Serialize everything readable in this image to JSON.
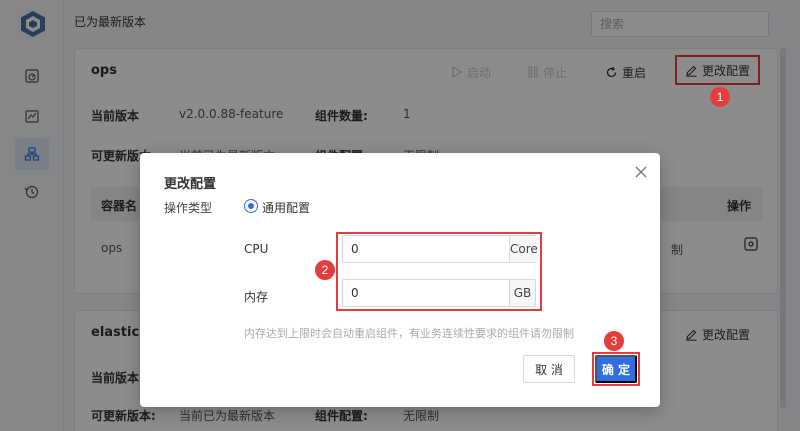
{
  "topbar": {
    "status": "已为最新版本",
    "search_placeholder": "搜索"
  },
  "sidebar": {
    "items": [
      {
        "icon": "dashboard-icon"
      },
      {
        "icon": "chart-icon"
      },
      {
        "icon": "deploy-icon"
      },
      {
        "icon": "history-icon"
      }
    ]
  },
  "card1": {
    "title": "ops",
    "actions": {
      "start": "启动",
      "stop": "停止",
      "restart": "重启",
      "change_config": "更改配置"
    },
    "info": {
      "current_version_label": "当前版本",
      "current_version": "v2.0.0.88-feature",
      "component_count_label": "组件数量:",
      "component_count": "1",
      "updatable_label": "可更新版本:",
      "updatable_value": "当前已为最新版本",
      "component_config_label": "组件配置:",
      "component_config_value": "无限制"
    },
    "table": {
      "headers": [
        "容器名",
        "操作"
      ],
      "row": {
        "name": "ops",
        "limit": "制"
      }
    }
  },
  "card2": {
    "title": "elasticse",
    "change_config": "更改配置",
    "info": {
      "current_version_label": "当前版本",
      "updatable_label": "可更新版本:",
      "updatable_value": "当前已为最新版本",
      "component_config_label": "组件配置:",
      "component_config_value": "无限制"
    }
  },
  "modal": {
    "title": "更改配置",
    "op_type_label": "操作类型",
    "radio_label": "通用配置",
    "cpu_label": "CPU",
    "cpu_value": "0",
    "cpu_unit": "Core",
    "mem_label": "内存",
    "mem_value": "0",
    "mem_unit": "GB",
    "hint": "内存达到上限时会自动重启组件，有业务连续性要求的组件请勿限制",
    "cancel": "取 消",
    "ok": "确 定"
  },
  "markers": [
    "1",
    "2",
    "3"
  ],
  "colors": {
    "primary": "#2f6fe0",
    "highlight": "#e43d3d"
  }
}
